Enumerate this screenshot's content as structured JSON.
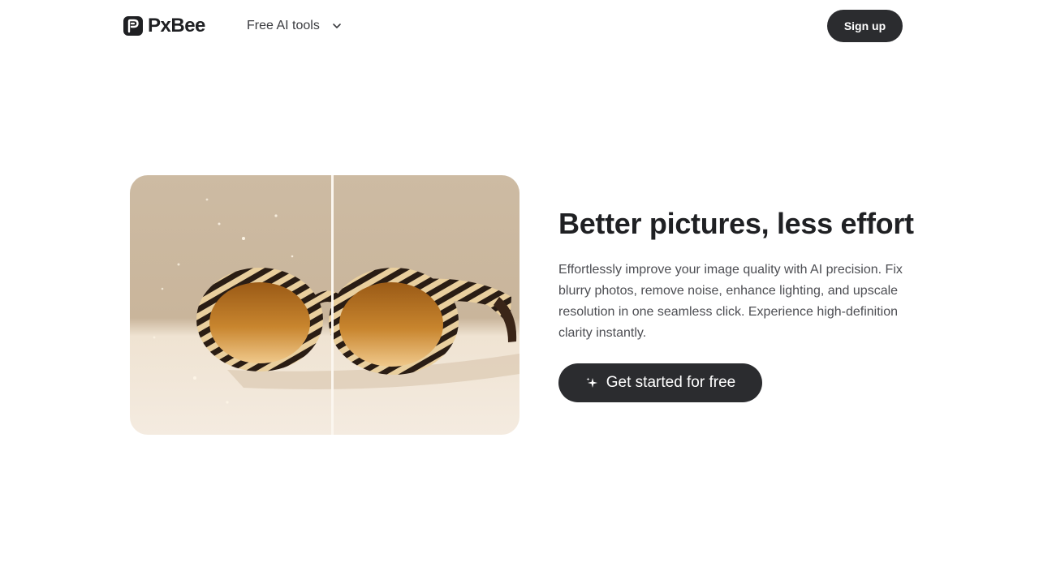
{
  "header": {
    "brand": "PxBee",
    "nav_dropdown_label": "Free AI tools",
    "signup_label": "Sign up"
  },
  "hero": {
    "title": "Better pictures, less effort",
    "description": "Effortlessly improve your image quality with AI precision. Fix blurry photos, remove noise, enhance lighting, and upscale resolution in one seamless click. Experience high-definition clarity instantly.",
    "cta_label": "Get started for free",
    "cta_icon": "sparkle-icon",
    "image_subject": "sunglasses-before-after"
  },
  "colors": {
    "button_dark": "#2b2c2f",
    "text_dark": "#1f2023",
    "text_muted": "#4d4e53"
  }
}
